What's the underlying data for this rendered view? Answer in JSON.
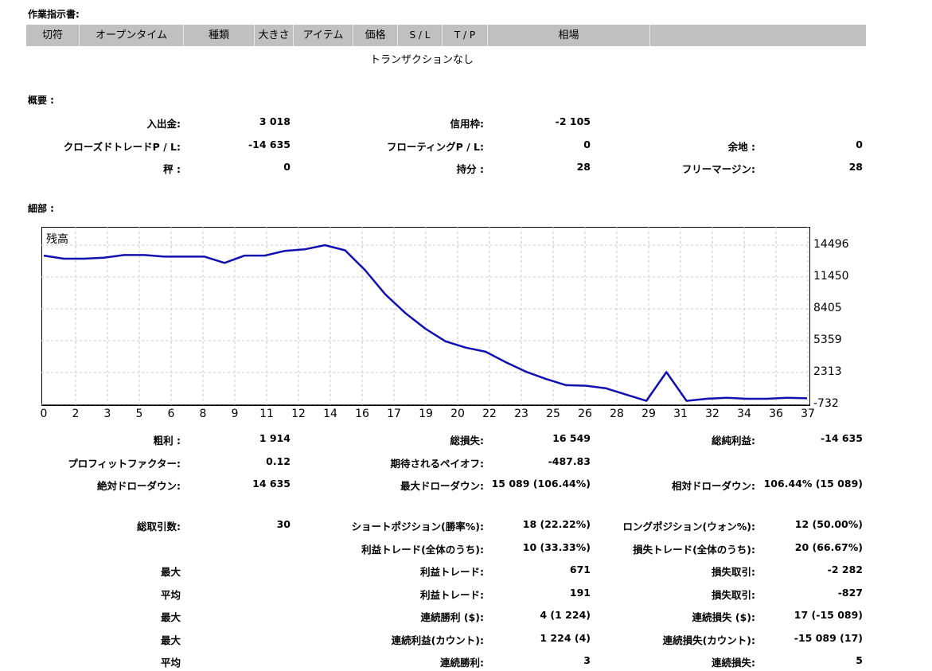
{
  "orders_section": {
    "title": "作業指示書:",
    "columns": [
      "切符",
      "オープンタイム",
      "種類",
      "大きさ",
      "アイテム",
      "価格",
      "S / L",
      "T / P",
      "相場",
      ""
    ],
    "empty_text": "トランザクションなし"
  },
  "summary_section": {
    "title": "概要 :",
    "rows": [
      [
        {
          "label": "入出金:",
          "value": "3 018"
        },
        {
          "label": "信用枠:",
          "value": "-2 105"
        },
        {
          "label": "",
          "value": ""
        }
      ],
      [
        {
          "label": "クローズドトレードP / L:",
          "value": "-14 635"
        },
        {
          "label": "フローティングP / L:",
          "value": "0"
        },
        {
          "label": "余地 :",
          "value": "0"
        }
      ],
      [
        {
          "label": "秤 :",
          "value": "0"
        },
        {
          "label": "持分 :",
          "value": "28"
        },
        {
          "label": "フリーマージン:",
          "value": "28"
        }
      ]
    ]
  },
  "details_section": {
    "title": "細部 :",
    "rows": [
      [
        {
          "label": "粗利 :",
          "value": "1 914"
        },
        {
          "label": "総損失:",
          "value": "16 549"
        },
        {
          "label": "総純利益:",
          "value": "-14 635"
        }
      ],
      [
        {
          "label": "プロフィットファクター:",
          "value": "0.12"
        },
        {
          "label": "期待されるペイオフ:",
          "value": "-487.83"
        },
        {
          "label": "",
          "value": ""
        }
      ],
      [
        {
          "label": "絶対ドローダウン:",
          "value": "14 635"
        },
        {
          "label": "最大ドローダウン:",
          "value": "15 089 (106.44%)"
        },
        {
          "label": "相対ドローダウン:",
          "value": "106.44% (15 089)"
        }
      ],
      [
        {
          "label": "総取引数:",
          "value": "30"
        },
        {
          "label": "ショートポジション(勝率%):",
          "value": "18 (22.22%)"
        },
        {
          "label": "ロングポジション(ウォン%):",
          "value": "12 (50.00%)"
        }
      ],
      [
        {
          "label": "",
          "value": ""
        },
        {
          "label": "利益トレード(全体のうち):",
          "value": "10 (33.33%)"
        },
        {
          "label": "損失トレード(全体のうち):",
          "value": "20 (66.67%)"
        }
      ],
      [
        {
          "label": "最大",
          "value": ""
        },
        {
          "label": "利益トレード:",
          "value": "671"
        },
        {
          "label": "損失取引:",
          "value": "-2 282"
        }
      ],
      [
        {
          "label": "平均",
          "value": ""
        },
        {
          "label": "利益トレード:",
          "value": "191"
        },
        {
          "label": "損失取引:",
          "value": "-827"
        }
      ],
      [
        {
          "label": "最大",
          "value": ""
        },
        {
          "label": "連続勝利 ($):",
          "value": "4 (1 224)"
        },
        {
          "label": "連続損失 ($):",
          "value": "17 (-15 089)"
        }
      ],
      [
        {
          "label": "最大",
          "value": ""
        },
        {
          "label": "連続利益(カウント):",
          "value": "1 224 (4)"
        },
        {
          "label": "連続損失(カウント):",
          "value": "-15 089 (17)"
        }
      ],
      [
        {
          "label": "平均",
          "value": ""
        },
        {
          "label": "連続勝利:",
          "value": "3"
        },
        {
          "label": "連続損失:",
          "value": "5"
        }
      ]
    ]
  },
  "chart_data": {
    "type": "line",
    "title": "残高",
    "x_tick_labels": [
      "0",
      "2",
      "3",
      "5",
      "6",
      "8",
      "9",
      "11",
      "12",
      "14",
      "16",
      "17",
      "19",
      "20",
      "22",
      "23",
      "25",
      "26",
      "28",
      "29",
      "31",
      "32",
      "34",
      "36",
      "37"
    ],
    "y_tick_labels": [
      "14496",
      "11450",
      "8405",
      "5359",
      "2313",
      "-732"
    ],
    "ylim": [
      -732,
      15900
    ],
    "xlim": [
      0,
      37.5
    ],
    "grid": true,
    "series_color": "#1010b0",
    "series": [
      {
        "x": [
          0,
          1,
          2,
          3,
          4,
          5,
          6,
          7,
          8,
          9,
          10,
          11,
          12,
          13,
          14,
          15,
          16,
          17,
          18,
          19,
          20,
          21,
          22,
          23,
          24,
          25,
          26,
          27,
          28,
          29,
          30,
          31,
          32,
          33,
          34,
          35,
          36,
          37,
          38
        ],
        "values": [
          13500,
          13200,
          13200,
          13300,
          13550,
          13550,
          13400,
          13400,
          13400,
          12800,
          13500,
          13500,
          13950,
          14100,
          14496,
          14000,
          12100,
          9800,
          8000,
          6500,
          5300,
          4700,
          4300,
          3300,
          2400,
          1700,
          1100,
          1050,
          800,
          200,
          -400,
          2350,
          -400,
          -200,
          -100,
          -200,
          -200,
          -100,
          -150
        ]
      }
    ]
  }
}
